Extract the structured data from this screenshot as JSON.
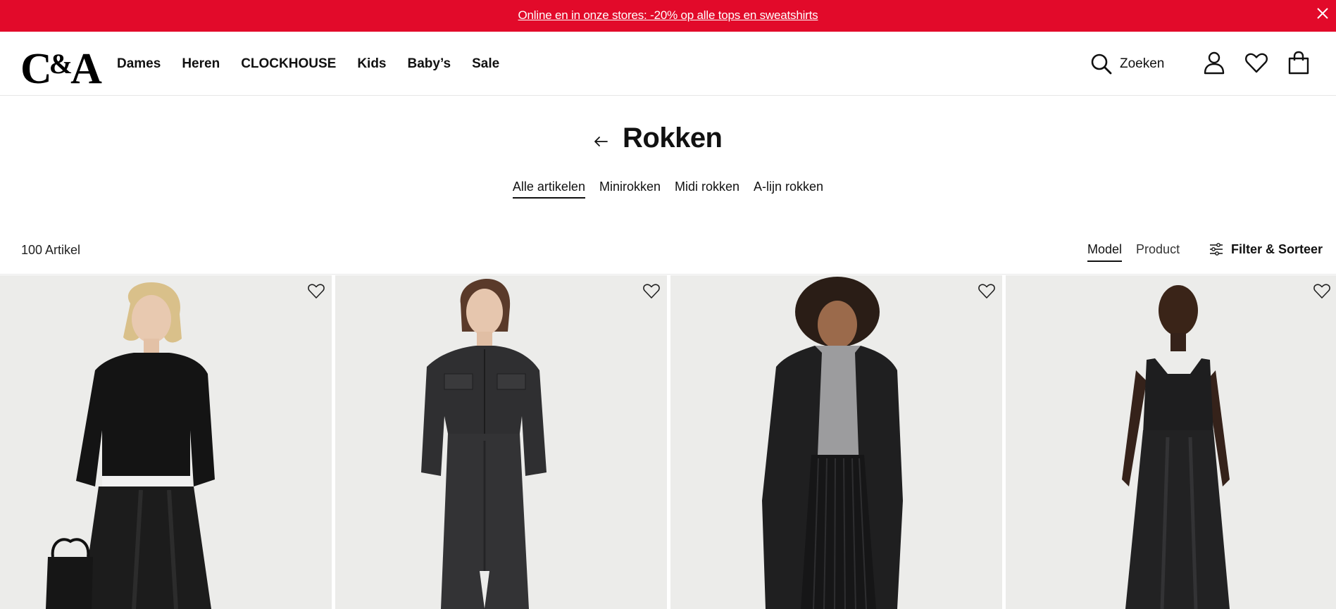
{
  "promo": {
    "text": "Online en in onze stores: -20% op alle tops en sweatshirts",
    "close_icon": "close-icon",
    "background": "#e20a2a"
  },
  "header": {
    "logo": "C&A",
    "nav": [
      "Dames",
      "Heren",
      "CLOCKHOUSE",
      "Kids",
      "Baby’s",
      "Sale"
    ],
    "search_label": "Zoeken",
    "icons": [
      "search-icon",
      "user-icon",
      "heart-icon",
      "shopping-bag-icon"
    ]
  },
  "page": {
    "title": "Rokken",
    "back_icon": "arrow-left-icon",
    "subcategories": [
      {
        "label": "Alle artikelen",
        "active": true
      },
      {
        "label": "Minirokken",
        "active": false
      },
      {
        "label": "Midi rokken",
        "active": false
      },
      {
        "label": "A-lijn rokken",
        "active": false
      }
    ]
  },
  "toolbar": {
    "count": "100 Artikel",
    "view_options": [
      {
        "label": "Model",
        "active": true
      },
      {
        "label": "Product",
        "active": false
      }
    ],
    "filter_label": "Filter & Sorteer",
    "filter_icon": "sliders-icon"
  },
  "products": [
    {
      "image": "model-black-sweater-satin-skirt",
      "wishlist_icon": "heart-outline-icon"
    },
    {
      "image": "model-denim-jacket-denim-skirt",
      "wishlist_icon": "heart-outline-icon"
    },
    {
      "image": "model-coat-pleated-skirt",
      "wishlist_icon": "heart-outline-icon"
    },
    {
      "image": "model-satin-top-satin-skirt",
      "wishlist_icon": "heart-outline-icon"
    }
  ]
}
